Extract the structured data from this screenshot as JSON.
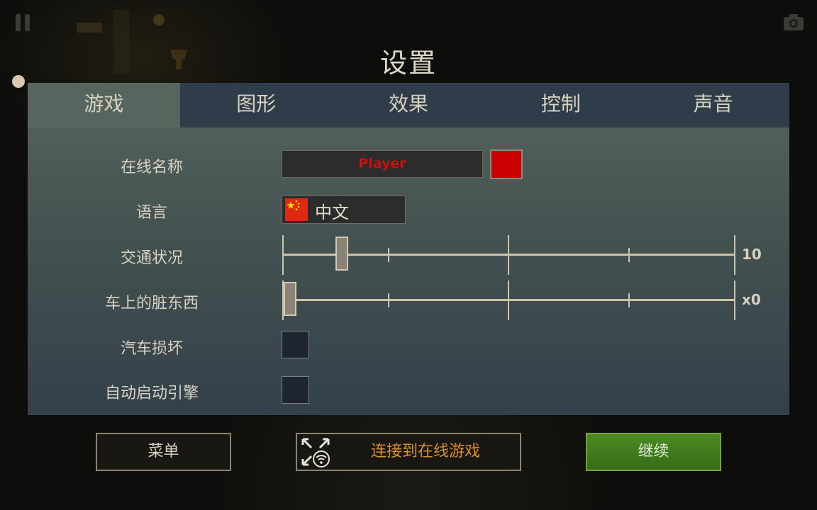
{
  "hud": {
    "pause_icon": "pause-icon",
    "camera_icon": "camera-icon"
  },
  "page_title": "设置",
  "tabs": [
    {
      "label": "游戏",
      "active": true
    },
    {
      "label": "图形",
      "active": false
    },
    {
      "label": "效果",
      "active": false
    },
    {
      "label": "控制",
      "active": false
    },
    {
      "label": "声音",
      "active": false
    }
  ],
  "settings": {
    "online_name": {
      "label": "在线名称",
      "value": "Player",
      "color": "#cc0000"
    },
    "language": {
      "label": "语言",
      "value": "中文",
      "flag": "china-flag-icon"
    },
    "traffic": {
      "label": "交通状况",
      "value": "10",
      "level": 0.115
    },
    "dirt": {
      "label": "车上的脏东西",
      "value": "x0",
      "level": 0.0
    },
    "car_damage": {
      "label": "汽车损坏",
      "checked": false
    },
    "auto_start": {
      "label": "自动启动引擎",
      "checked": false
    }
  },
  "buttons": {
    "menu": "菜单",
    "online": "连接到在线游戏",
    "continue": "继续"
  },
  "colors": {
    "panel_top": "#56655f",
    "tab_bar": "#2f3c49",
    "accent_orange": "#d8902a",
    "continue_green": "#4a8a22",
    "name_red": "#c81010"
  }
}
